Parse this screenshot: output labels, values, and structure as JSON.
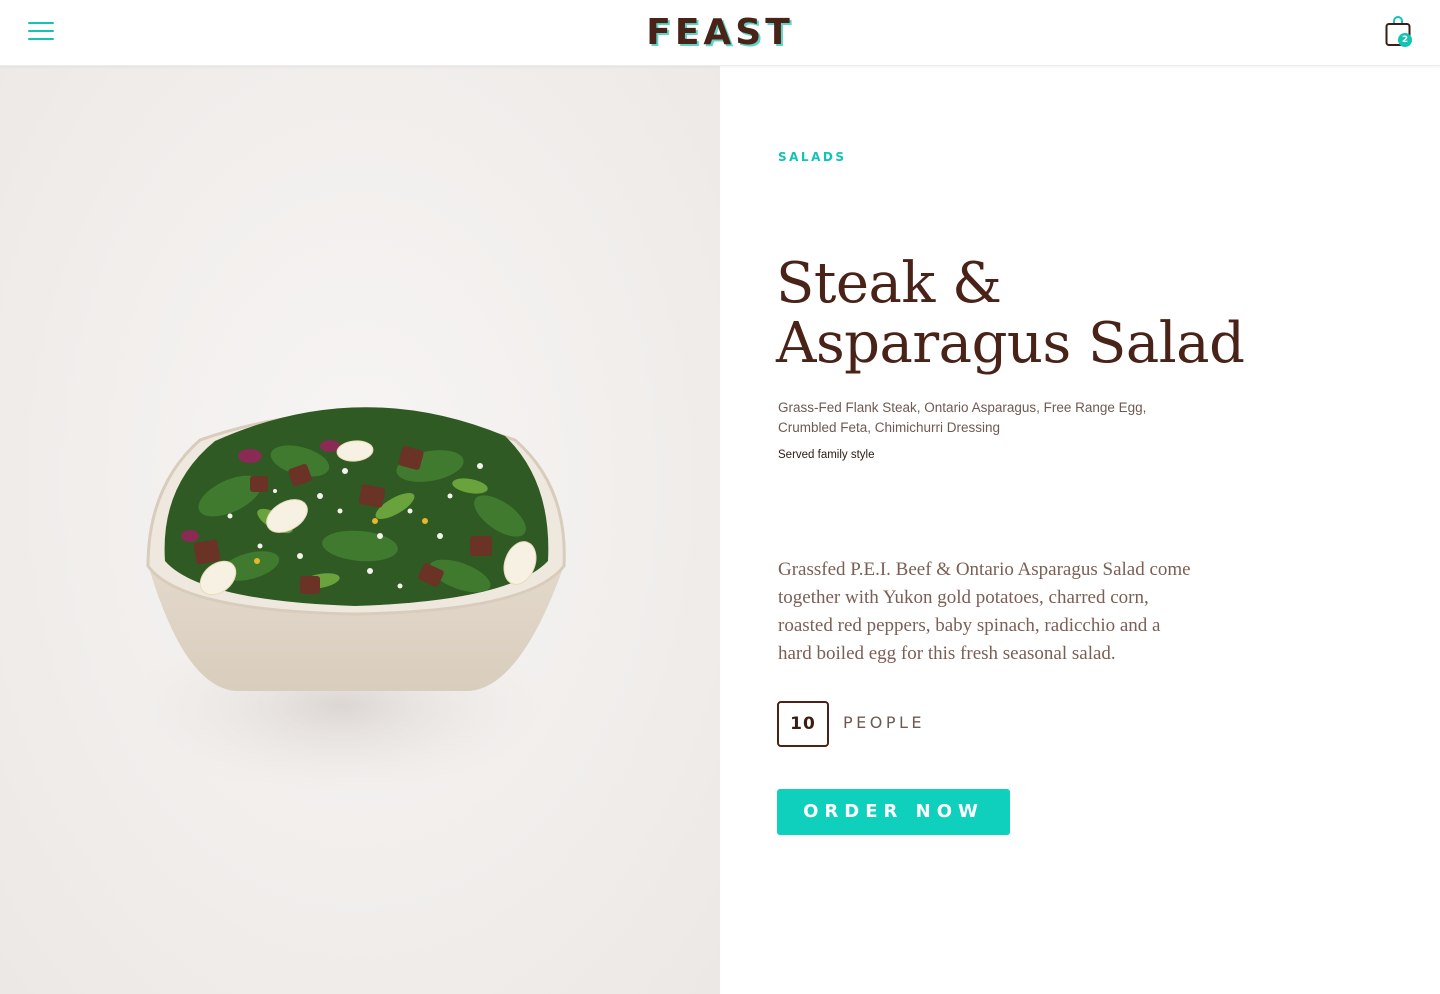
{
  "header": {
    "logo": "FEAST",
    "cart_count": "2"
  },
  "product": {
    "category": "SALADS",
    "title_line1": "Steak &",
    "title_line2": "Asparagus Salad",
    "ingredients_line1": "Grass-Fed Flank Steak, Ontario Asparagus, Free Range Egg,",
    "ingredients_line2": "Crumbled Feta, Chimichurri Dressing",
    "served": "Served family style",
    "description_lines": [
      "Grassfed P.E.I. Beef & Ontario Asparagus Salad come",
      "together with Yukon gold potatoes, charred corn,",
      "roasted red peppers, baby spinach, radicchio and a",
      "hard boiled egg for this fresh seasonal salad."
    ],
    "quantity": "10",
    "quantity_unit": "PEOPLE",
    "order_button": "ORDER NOW"
  },
  "colors": {
    "accent": "#0fd0bd",
    "brand_brown": "#4a2318",
    "image_background": "#f1eeec"
  },
  "icons": {
    "menu": "hamburger-menu-icon",
    "cart": "shopping-bag-icon"
  }
}
